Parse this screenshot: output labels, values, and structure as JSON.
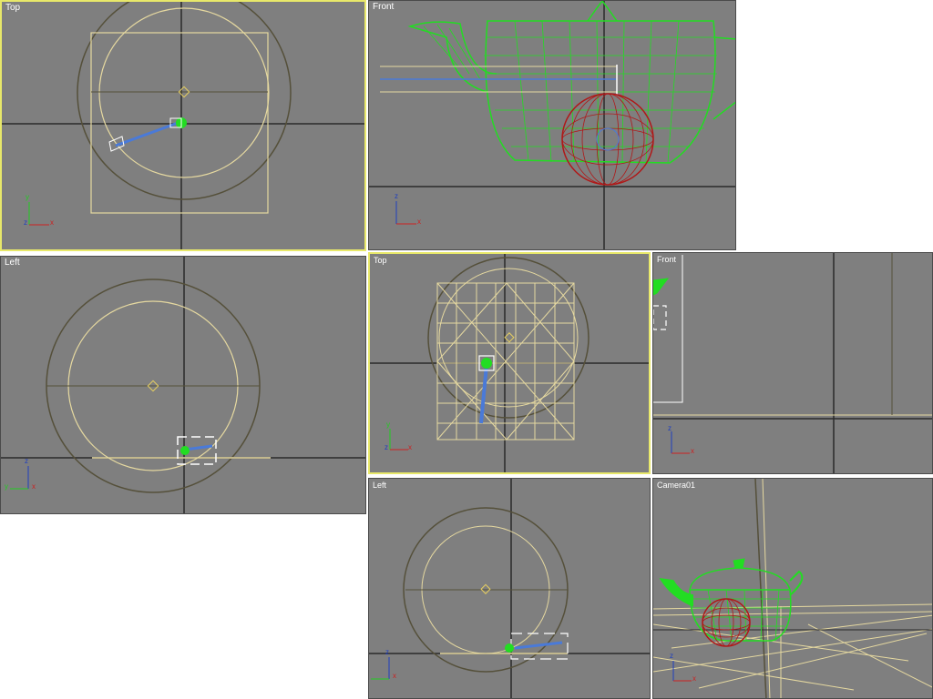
{
  "screenshot_a": {
    "viewports": [
      {
        "id": "top",
        "label": "Top",
        "active": true
      },
      {
        "id": "front",
        "label": "Front",
        "active": false
      },
      {
        "id": "left",
        "label": "Left",
        "active": false
      }
    ]
  },
  "screenshot_b": {
    "viewports": [
      {
        "id": "top",
        "label": "Top",
        "active": true
      },
      {
        "id": "front",
        "label": "Front",
        "active": false
      },
      {
        "id": "left",
        "label": "Left",
        "active": false
      },
      {
        "id": "camera",
        "label": "Camera01",
        "active": false
      }
    ]
  },
  "axis_labels": {
    "x": "x",
    "y": "y",
    "z": "z"
  },
  "colors": {
    "viewport_bg": "#7f7f7f",
    "active_border": "#e8e86a",
    "grid_line": "#2a2a2a",
    "light_cone": "#e6d9a0",
    "teapot_wire": "#22dd22",
    "sphere_wire": "#b01818",
    "gizmo_blue": "#4a7ad8"
  }
}
